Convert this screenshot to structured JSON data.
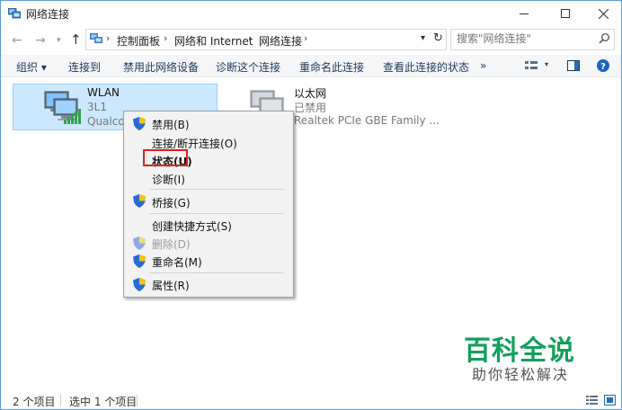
{
  "window": {
    "title": "网络连接"
  },
  "address": {
    "crumbs": [
      "控制面板",
      "网络和 Internet",
      "网络连接"
    ],
    "search_placeholder": "搜索\"网络连接\""
  },
  "commands": [
    "组织 ▾",
    "连接到",
    "禁用此网络设备",
    "诊断这个连接",
    "重命名此连接",
    "查看此连接的状态",
    "»"
  ],
  "items": [
    {
      "name": "WLAN",
      "status": "3L1",
      "device": "Qualcor",
      "selected": true,
      "signal_icon": "wifi-signal-icon"
    },
    {
      "name": "以太网",
      "status": "已禁用",
      "device": "Realtek PCIe GBE Family ...",
      "selected": false
    }
  ],
  "context_menu": {
    "items": [
      {
        "label": "禁用(B)",
        "shield": true,
        "disabled": false,
        "bold": false
      },
      {
        "label": "连接/断开连接(O)",
        "shield": false,
        "disabled": false,
        "bold": false
      },
      {
        "label": "状态(U)",
        "shield": false,
        "disabled": false,
        "bold": true,
        "highlighted": true
      },
      {
        "label": "诊断(I)",
        "shield": false,
        "disabled": false,
        "bold": false
      },
      {
        "label": "桥接(G)",
        "shield": true,
        "disabled": false,
        "bold": false
      },
      {
        "label": "创建快捷方式(S)",
        "shield": false,
        "disabled": false,
        "bold": false
      },
      {
        "label": "删除(D)",
        "shield": true,
        "disabled": true,
        "bold": false
      },
      {
        "label": "重命名(M)",
        "shield": true,
        "disabled": false,
        "bold": false
      },
      {
        "label": "属性(R)",
        "shield": true,
        "disabled": false,
        "bold": false
      }
    ]
  },
  "statusbar": {
    "count": "2 个项目",
    "selected": "选中 1 个项目"
  },
  "watermark": {
    "main": "百科全说",
    "sub": "助你轻松解决"
  },
  "colors": {
    "accent": "#0078d7",
    "selection": "#cce8ff",
    "highlight_border": "#e02020",
    "watermark_green": "#13a05d"
  }
}
